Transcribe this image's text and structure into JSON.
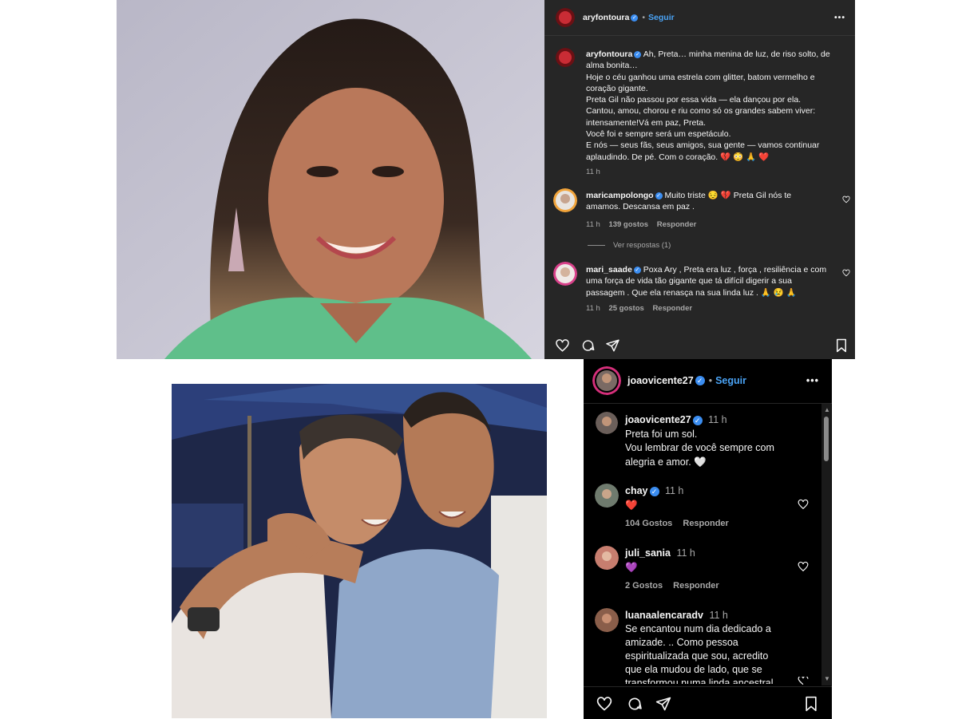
{
  "top_post": {
    "header": {
      "username": "aryfontoura",
      "separator": "•",
      "follow_label": "Seguir",
      "more": "•••"
    },
    "caption": {
      "username": "aryfontoura",
      "lines": [
        "Ah, Preta… minha menina de luz, de riso solto, de",
        "alma bonita…",
        "Hoje o céu ganhou uma estrela com glitter, batom vermelho e",
        "coração gigante.",
        "Preta Gil não passou por essa vida — ela dançou por ela.",
        "Cantou, amou, chorou e riu como só os grandes sabem viver:",
        "intensamente!Vá em paz, Preta.",
        "Você foi e sempre será um espetáculo.",
        "E nós — seus fãs, seus amigos, sua gente — vamos continuar",
        "aplaudindo. De pé. Com o coração. 💔 😳 🙏 ❤️"
      ],
      "time": "11 h"
    },
    "comments": [
      {
        "username": "maricampolongo",
        "lines": [
          "Muito triste 😔 💔 Preta Gil nós te",
          "amamos. Descansa em paz ."
        ],
        "time": "11 h",
        "likes": "139 gostos",
        "reply": "Responder"
      },
      {
        "username": "mari_saade",
        "lines": [
          "Poxa Ary , Preta era luz , força , resiliência e com",
          "uma força de vida tão gigante que tá difícil digerir a sua",
          "passagem . Que ela renasça na sua linda luz . 🙏 😢 🙏"
        ],
        "time": "11 h",
        "likes": "25 gostos",
        "reply": "Responder"
      }
    ],
    "view_replies": "Ver respostas (1)",
    "action_icons": [
      "heart-icon",
      "comment-icon",
      "share-icon",
      "bookmark-icon"
    ]
  },
  "bottom_post": {
    "header": {
      "username": "joaovicente27",
      "separator": "•",
      "follow_label": "Seguir",
      "more": "•••"
    },
    "caption": {
      "username": "joaovicente27",
      "time": "11 h",
      "lines": [
        "Preta foi um sol.",
        "Vou lembrar de você sempre com",
        "alegria e amor. 🤍"
      ]
    },
    "comments": [
      {
        "username": "chay",
        "time": "11 h",
        "lines": [
          "❤️"
        ],
        "likes": "104 Gostos",
        "reply": "Responder"
      },
      {
        "username": "juli_sania",
        "time": "11 h",
        "lines": [
          "💜"
        ],
        "likes": "2 Gostos",
        "reply": "Responder"
      },
      {
        "username": "luanaalencaradv",
        "time": "11 h",
        "lines": [
          "Se encantou num dia dedicado a",
          "amizade. .. Como pessoa",
          "espiritualizada que sou, acredito",
          "que ela mudou de lado, que se",
          "transformou numa linda ancestral"
        ]
      }
    ],
    "action_icons": [
      "heart-icon",
      "comment-icon",
      "share-icon",
      "bookmark-icon"
    ]
  },
  "colors": {
    "panel_top": "#262626",
    "panel_bottom": "#000000",
    "link_blue": "#4aa3f5",
    "verified": "#3b8df0",
    "blouse_green": "#5fbf8a"
  }
}
